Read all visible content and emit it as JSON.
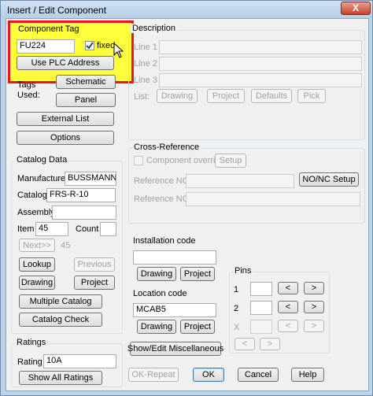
{
  "window": {
    "title": "Insert / Edit Component",
    "close_label": "X"
  },
  "component_tag": {
    "group_label": "Component Tag",
    "value": "FU224",
    "fixed_label": "fixed",
    "fixed_checked": true,
    "use_plc_label": "Use PLC Address",
    "tags_used_label": "Tags Used:",
    "schematic_label": "Schematic",
    "panel_label": "Panel",
    "external_list_label": "External List",
    "options_label": "Options"
  },
  "description": {
    "group_label": "Description",
    "line1": "Line 1",
    "line2": "Line 2",
    "line3": "Line 3",
    "list_label": "List:",
    "drawing_label": "Drawing",
    "project_label": "Project",
    "defaults_label": "Defaults",
    "pick_label": "Pick"
  },
  "catalog": {
    "group_label": "Catalog Data",
    "manufacturer_label": "Manufacturer",
    "manufacturer_value": "BUSSMANN",
    "catalog_label": "Catalog",
    "catalog_value": "FRS-R-10",
    "assembly_label": "Assembly",
    "assembly_value": "",
    "item_label": "Item",
    "item_value": "45",
    "count_label": "Count",
    "count_value": "",
    "next_label": "Next>>",
    "next_value": "45",
    "lookup_label": "Lookup",
    "previous_label": "Previous",
    "drawing_label": "Drawing",
    "project_label": "Project",
    "multiple_label": "Multiple Catalog",
    "check_label": "Catalog Check"
  },
  "cross_reference": {
    "group_label": "Cross-Reference",
    "override_label": "Component override",
    "setup_label": "Setup",
    "ref_no_label": "Reference NO",
    "ref_nc_label": "Reference NC",
    "nonc_setup_label": "NO/NC Setup"
  },
  "installation": {
    "group_label": "Installation code",
    "value": "",
    "drawing_label": "Drawing",
    "project_label": "Project"
  },
  "location": {
    "group_label": "Location code",
    "value": "MCAB5",
    "drawing_label": "Drawing",
    "project_label": "Project"
  },
  "pins": {
    "group_label": "Pins",
    "row1_label": "1",
    "row2_label": "2",
    "rowx_label": "X",
    "prev_label": "<",
    "next_label": ">"
  },
  "ratings": {
    "group_label": "Ratings",
    "rating_label": "Rating",
    "rating_value": "10A",
    "show_all_label": "Show All Ratings"
  },
  "show_edit_misc_label": "Show/Edit Miscellaneous",
  "footer": {
    "ok_repeat_label": "OK-Repeat",
    "ok_label": "OK",
    "cancel_label": "Cancel",
    "help_label": "Help"
  },
  "colors": {
    "highlight_fill": "#ffff3c",
    "highlight_border": "#e8141e"
  }
}
